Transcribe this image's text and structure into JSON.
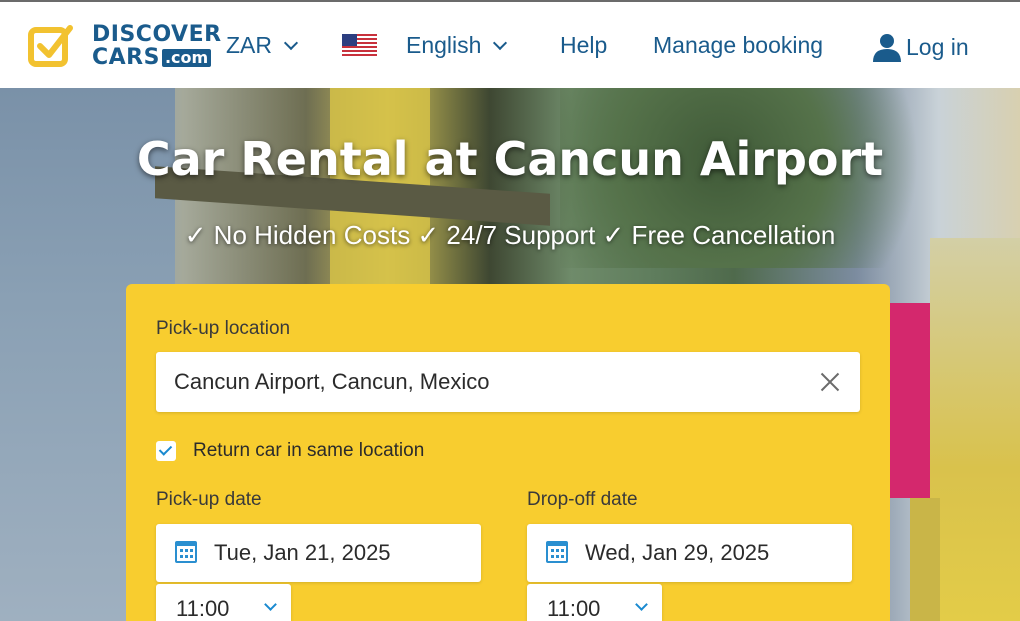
{
  "header": {
    "logo_line1": "DISCOVER",
    "logo_line2": "CARS",
    "logo_suffix": ".com",
    "currency": "ZAR",
    "language": "English",
    "help": "Help",
    "manage_booking": "Manage booking",
    "login": "Log in",
    "flag_icon": "us-flag-icon",
    "user_icon": "user-icon"
  },
  "hero": {
    "title": "Car Rental at Cancun Airport",
    "subtitle": "✓ No Hidden Costs ✓ 24/7 Support ✓ Free Cancellation"
  },
  "search": {
    "pickup_location_label": "Pick-up location",
    "pickup_location_value": "Cancun Airport, Cancun, Mexico",
    "return_same_label": "Return car in same location",
    "return_same_checked": true,
    "pickup_date_label": "Pick-up date",
    "pickup_date_value": "Tue, Jan 21, 2025",
    "pickup_time_value": "11:00",
    "dropoff_date_label": "Drop-off date",
    "dropoff_date_value": "Wed, Jan 29, 2025",
    "dropoff_time_value": "11:00"
  },
  "colors": {
    "brand_blue": "#1a5b8c",
    "accent_yellow": "#f8cd2f",
    "icon_blue": "#2a8fd0"
  }
}
